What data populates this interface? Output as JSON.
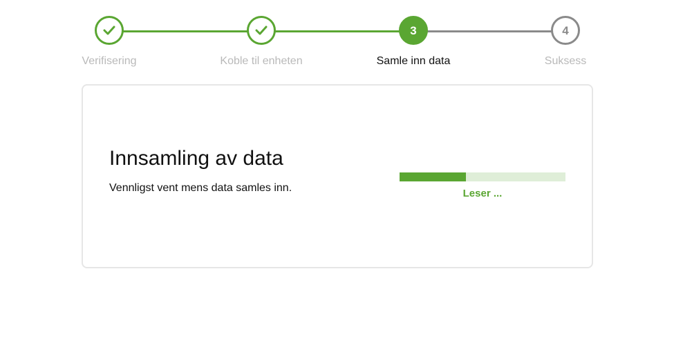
{
  "colors": {
    "accent": "#5aa632",
    "inactive": "#8a8a8a",
    "muted_label": "#b9b9b9",
    "progress_track": "#dfeed8",
    "text": "#111111"
  },
  "stepper": {
    "steps": [
      {
        "label": "Verifisering",
        "status": "completed",
        "icon": "checkmark-icon"
      },
      {
        "label": "Koble til enheten",
        "status": "completed",
        "icon": "checkmark-icon"
      },
      {
        "label": "Samle inn data",
        "status": "active",
        "number": "3"
      },
      {
        "label": "Suksess",
        "status": "pending",
        "number": "4"
      }
    ]
  },
  "card": {
    "title": "Innsamling av data",
    "subtitle": "Vennligst vent mens data samles inn.",
    "progress": {
      "fraction": 0.4,
      "status_text": "Leser ..."
    }
  }
}
